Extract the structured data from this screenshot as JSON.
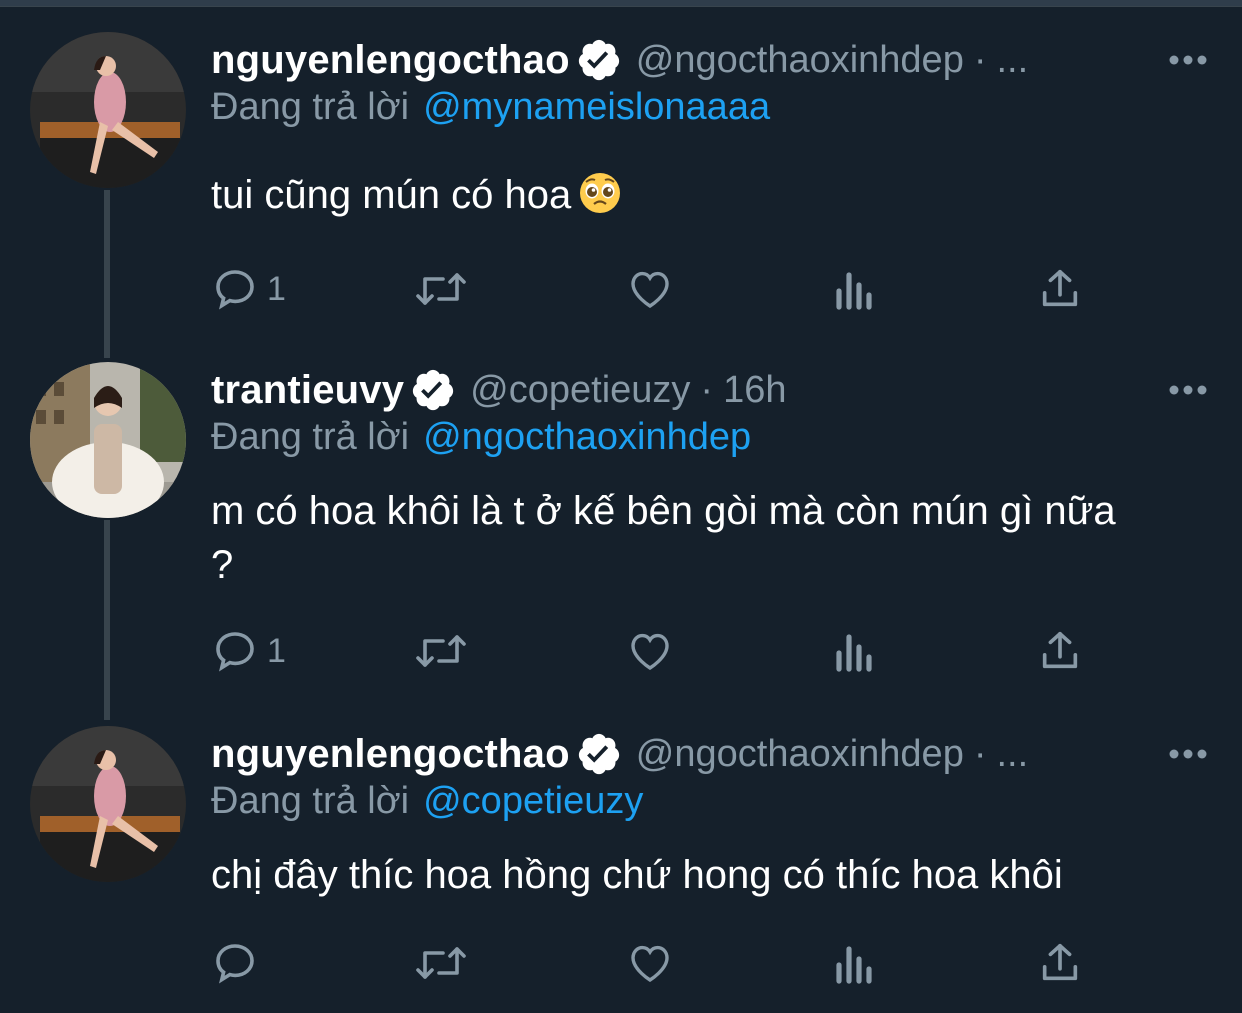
{
  "colors": {
    "background": "#15202b",
    "text_primary": "#ffffff",
    "text_secondary": "#8899a6",
    "accent": "#1da1f2",
    "thread_line": "#38444d"
  },
  "tweets": [
    {
      "display_name": "nguyenlengocthao",
      "verified": true,
      "handle": "@ngocthaoxinhdep",
      "time": "...",
      "replying_label": "Đang trả lời",
      "replying_to": "@mynameislonaaaa",
      "text": "tui cũng mún có hoa",
      "emoji": "pleading-face-emoji",
      "reply_count": "1",
      "retweet_count": "",
      "like_count": ""
    },
    {
      "display_name": "trantieuvy",
      "verified": true,
      "handle": "@copetieuzy",
      "time": "16h",
      "replying_label": "Đang trả lời",
      "replying_to": "@ngocthaoxinhdep",
      "text": "m có hoa khôi là t ở kế bên gòi mà còn mún gì nữa ?",
      "reply_count": "1",
      "retweet_count": "",
      "like_count": ""
    },
    {
      "display_name": "nguyenlengocthao",
      "verified": true,
      "handle": "@ngocthaoxinhdep",
      "time": "...",
      "replying_label": "Đang trả lời",
      "replying_to": "@copetieuzy",
      "text": "chị đây thíc hoa hồng chứ hong có thíc hoa khôi",
      "reply_count": "",
      "retweet_count": "",
      "like_count": ""
    }
  ],
  "icons": {
    "reply": "reply-icon",
    "retweet": "retweet-icon",
    "like": "heart-icon",
    "analytics": "analytics-icon",
    "share": "share-icon",
    "more": "more-icon",
    "verified": "verified-badge-icon"
  }
}
